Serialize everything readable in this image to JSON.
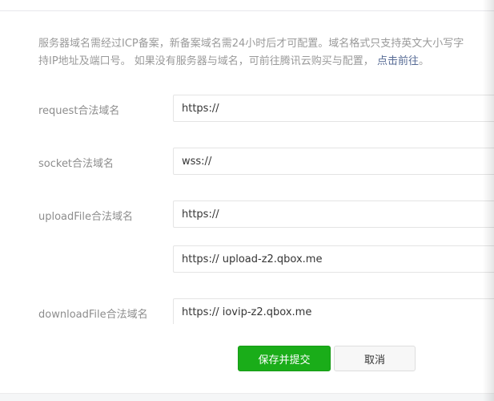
{
  "notice": {
    "line1": "服务器域名需经过ICP备案，新备案域名需24小时后才可配置。域名格式只支持英文大小写字",
    "line2_prefix": "持IP地址及端口号。 如果没有服务器与域名，可前往腾讯云购买与配置，",
    "link": "点击前往",
    "line2_suffix": "。"
  },
  "fields": {
    "request": {
      "label": "request合法域名",
      "value": "https://"
    },
    "socket": {
      "label": "socket合法域名",
      "value": "wss://"
    },
    "uploadFile": {
      "label": "uploadFile合法域名",
      "value1": "https://",
      "value2": "https:// upload-z2.qbox.me"
    },
    "downloadFile": {
      "label": "downloadFile合法域名",
      "value": "https:// iovip-z2.qbox.me"
    }
  },
  "buttons": {
    "save_submit": "保存并提交",
    "cancel": "取消"
  },
  "colors": {
    "primary": "#1aad19",
    "link": "#576b95"
  }
}
